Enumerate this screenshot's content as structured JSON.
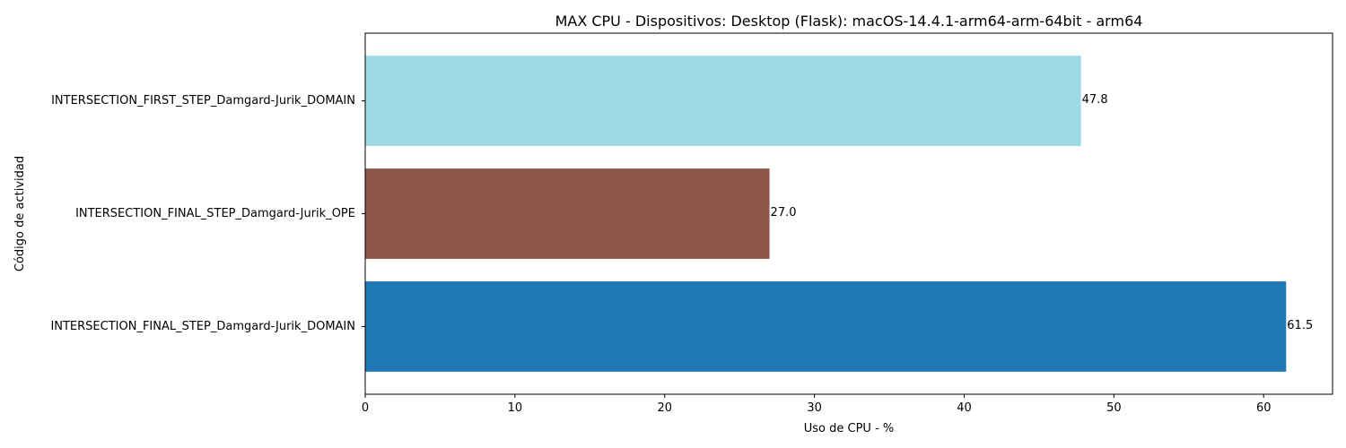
{
  "chart_data": {
    "type": "bar",
    "orientation": "horizontal",
    "title": "MAX CPU - Dispositivos: Desktop (Flask): macOS-14.4.1-arm64-arm-64bit - arm64",
    "xlabel": "Uso de CPU - %",
    "ylabel": "Código de actividad",
    "xlim": [
      0,
      64.6
    ],
    "xticks": [
      0,
      10,
      20,
      30,
      40,
      50,
      60
    ],
    "grid": false,
    "categories": [
      "INTERSECTION_FINAL_STEP_Damgard-Jurik_DOMAIN",
      "INTERSECTION_FINAL_STEP_Damgard-Jurik_OPE",
      "INTERSECTION_FIRST_STEP_Damgard-Jurik_DOMAIN"
    ],
    "values": [
      61.5,
      27.0,
      47.8
    ],
    "data_labels": [
      "61.5",
      "27.0",
      "47.8"
    ],
    "colors": [
      "#1f77b4",
      "#8c564b",
      "#9edae5"
    ]
  }
}
